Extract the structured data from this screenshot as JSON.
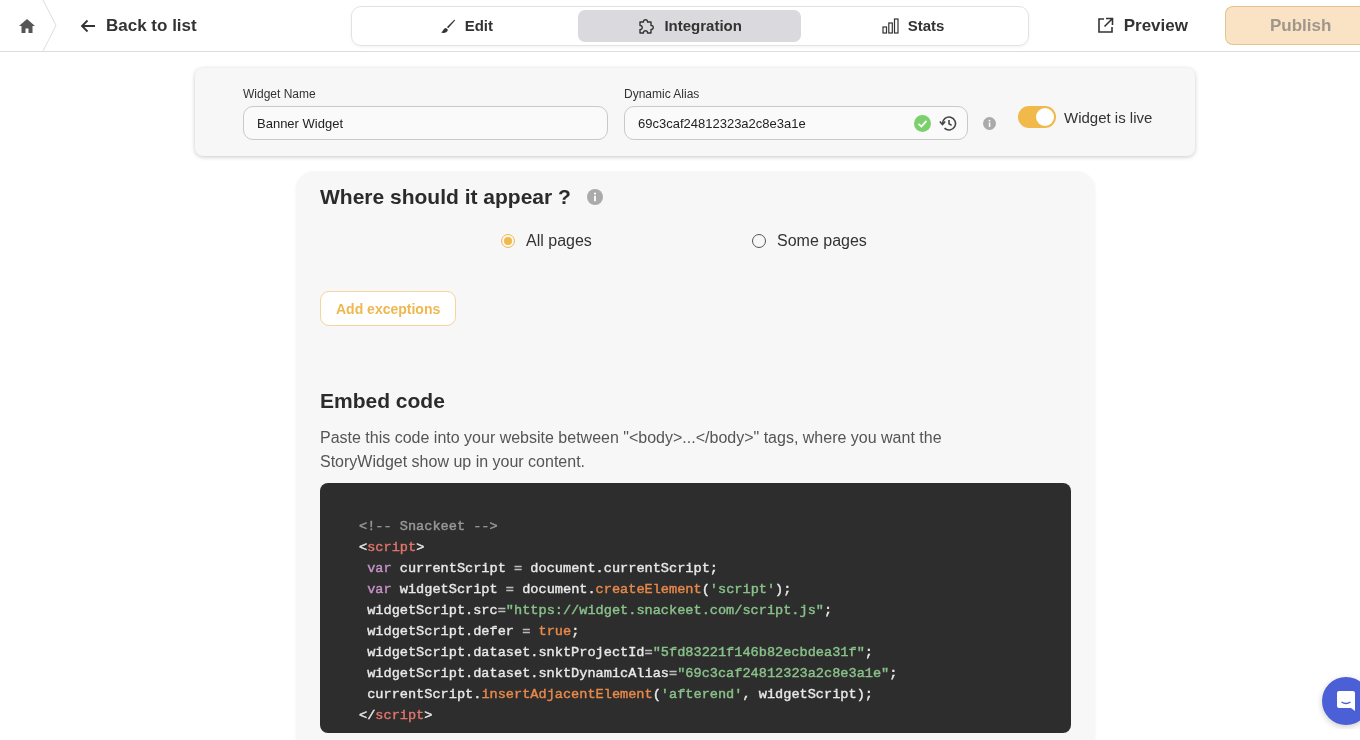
{
  "nav": {
    "back": "Back to list",
    "tabs": [
      {
        "label": "Edit",
        "selected": false
      },
      {
        "label": "Integration",
        "selected": true
      },
      {
        "label": "Stats",
        "selected": false
      }
    ],
    "preview": "Preview",
    "publish": {
      "label": "Publish",
      "disabled": true
    }
  },
  "widget": {
    "name_label": "Widget Name",
    "name_value": "Banner Widget",
    "alias_label": "Dynamic Alias",
    "alias_value": "69c3caf24812323a2c8e3a1e",
    "alias_valid": true,
    "live": {
      "label": "Widget is live",
      "on": true
    }
  },
  "placement": {
    "title": "Where should it appear ?",
    "options": [
      {
        "label": "All pages",
        "selected": true
      },
      {
        "label": "Some pages",
        "selected": false
      }
    ],
    "exceptions_button": "Add exceptions"
  },
  "embed": {
    "title": "Embed code",
    "description": "Paste this code into your website between \"<body>...</body>\" tags, where you want the StoryWidget show up in your content.",
    "code": [
      [
        {
          "t": "<!-- Snackeet -->",
          "color": "#999999"
        }
      ],
      [
        {
          "t": "<",
          "color": "#e8e8e8"
        },
        {
          "t": "script",
          "color": "#e0746b"
        },
        {
          "t": ">",
          "color": "#e8e8e8"
        }
      ],
      [
        {
          "t": " var",
          "color": "#c792c9"
        },
        {
          "t": " currentScript ",
          "color": "#e8e8e8"
        },
        {
          "t": "=",
          "color": "#bbbbbb"
        },
        {
          "t": " document.currentScript;",
          "color": "#e8e8e8"
        }
      ],
      [
        {
          "t": " var",
          "color": "#c792c9"
        },
        {
          "t": " widgetScript ",
          "color": "#e8e8e8"
        },
        {
          "t": "=",
          "color": "#bbbbbb"
        },
        {
          "t": " document.",
          "color": "#e8e8e8"
        },
        {
          "t": "createElement",
          "color": "#e8894a"
        },
        {
          "t": "(",
          "color": "#e8e8e8"
        },
        {
          "t": "'script'",
          "color": "#89c28a"
        },
        {
          "t": ");",
          "color": "#e8e8e8"
        }
      ],
      [
        {
          "t": " widgetScript.src",
          "color": "#e8e8e8"
        },
        {
          "t": "=",
          "color": "#bbbbbb"
        },
        {
          "t": "\"https://widget.snackeet.com/script.js\"",
          "color": "#89c28a"
        },
        {
          "t": ";",
          "color": "#e8e8e8"
        }
      ],
      [
        {
          "t": " widgetScript.defer ",
          "color": "#e8e8e8"
        },
        {
          "t": "=",
          "color": "#bbbbbb"
        },
        {
          "t": " true",
          "color": "#e8894a"
        },
        {
          "t": ";",
          "color": "#e8e8e8"
        }
      ],
      [
        {
          "t": " widgetScript.dataset.snktProjectId",
          "color": "#e8e8e8"
        },
        {
          "t": "=",
          "color": "#bbbbbb"
        },
        {
          "t": "\"5fd83221f146b82ecbdea31f\"",
          "color": "#89c28a"
        },
        {
          "t": ";",
          "color": "#e8e8e8"
        }
      ],
      [
        {
          "t": " widgetScript.dataset.snktDynamicAlias",
          "color": "#e8e8e8"
        },
        {
          "t": "=",
          "color": "#bbbbbb"
        },
        {
          "t": "\"69c3caf24812323a2c8e3a1e\"",
          "color": "#89c28a"
        },
        {
          "t": ";",
          "color": "#e8e8e8"
        }
      ],
      [
        {
          "t": " currentScript.",
          "color": "#e8e8e8"
        },
        {
          "t": "insertAdjacentElement",
          "color": "#e8894a"
        },
        {
          "t": "(",
          "color": "#e8e8e8"
        },
        {
          "t": "'afterend'",
          "color": "#89c28a"
        },
        {
          "t": ", widgetScript);",
          "color": "#e8e8e8"
        }
      ],
      [
        {
          "t": "</",
          "color": "#e8e8e8"
        },
        {
          "t": "script",
          "color": "#e0746b"
        },
        {
          "t": ">",
          "color": "#e8e8e8"
        }
      ]
    ]
  }
}
